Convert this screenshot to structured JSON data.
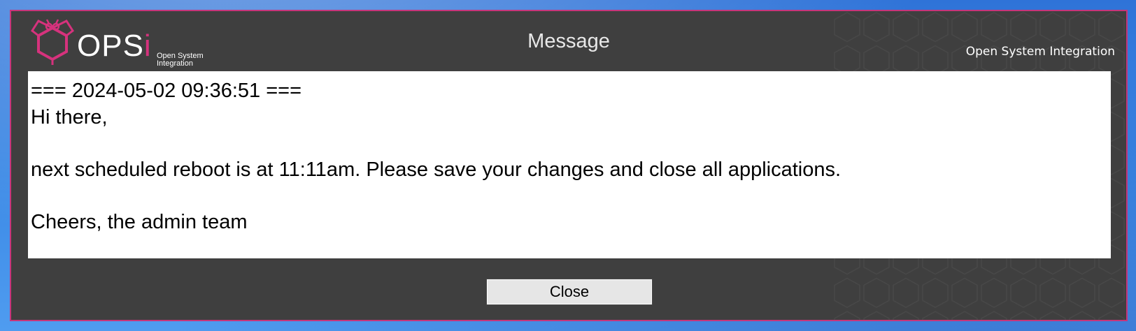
{
  "window": {
    "title": "Message",
    "border_color": "#c7357a",
    "background_color": "#3f3f3f"
  },
  "logo": {
    "wordmark_main": "OPS",
    "wordmark_accent": "i",
    "tagline": "Open System Integration",
    "accent_color": "#d6327d"
  },
  "brand": {
    "right_text": "Open System Integration"
  },
  "message": {
    "lines": [
      "=== 2024-05-02 09:36:51 ===",
      "Hi there,",
      "",
      "next scheduled reboot is at 11:11am. Please save your changes and close all applications.",
      "",
      "Cheers, the admin team"
    ]
  },
  "buttons": {
    "close_label": "Close"
  }
}
